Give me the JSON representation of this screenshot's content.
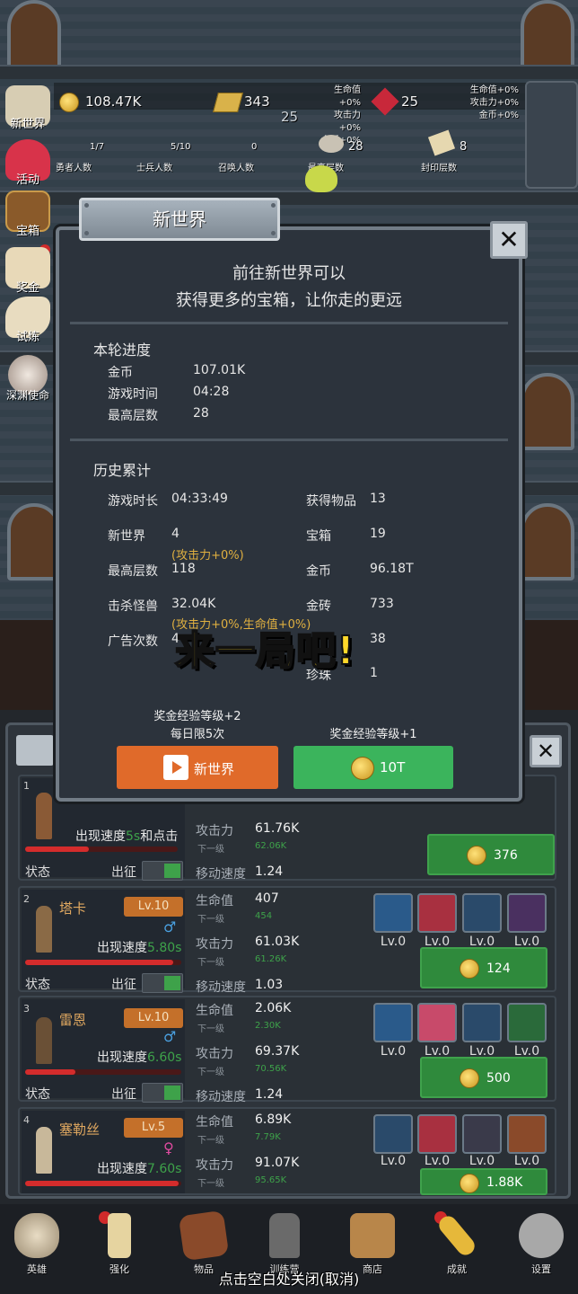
{
  "top": {
    "gold": "108.47K",
    "bricks": "343",
    "gem": "25",
    "stat_left": [
      "生命值+0%",
      "攻击力+0%",
      "金币+0%"
    ],
    "stat_right": [
      "生命值+0%",
      "攻击力+0%",
      "金币+0%"
    ],
    "floor_num": "25",
    "hero_count": "1/7",
    "hero_count_label": "勇者人数",
    "soldier_count": "5/10",
    "soldier_count_label": "士兵人数",
    "summon_count": "0",
    "summon_count_label": "召唤人数",
    "max_floor": "28",
    "max_floor_label": "最高层数",
    "seal_floor": "8",
    "seal_floor_label": "封印层数"
  },
  "side": [
    "新世界",
    "活动",
    "宝箱",
    "奖金",
    "试炼",
    "深渊使命"
  ],
  "dialog": {
    "title": "新世界",
    "close": "✕",
    "intro_line1": "前往新世界可以",
    "intro_line2": "获得更多的宝箱，让你走的更远",
    "round_title": "本轮进度",
    "round": [
      {
        "label": "金币",
        "value": "107.01K"
      },
      {
        "label": "游戏时间",
        "value": "04:28"
      },
      {
        "label": "最高层数",
        "value": "28"
      }
    ],
    "history_title": "历史累计",
    "history_left": [
      {
        "label": "游戏时长",
        "value": "04:33:49",
        "note": ""
      },
      {
        "label": "新世界",
        "value": "4",
        "note": "(攻击力+0%)"
      },
      {
        "label": "最高层数",
        "value": "118",
        "note": ""
      },
      {
        "label": "击杀怪兽",
        "value": "32.04K",
        "note": "(攻击力+0%,生命值+0%)"
      },
      {
        "label": "广告次数",
        "value": "4",
        "note": ""
      }
    ],
    "history_right": [
      {
        "label": "获得物品",
        "value": "13"
      },
      {
        "label": "宝箱",
        "value": "19"
      },
      {
        "label": "金币",
        "value": "96.18T"
      },
      {
        "label": "金砖",
        "value": "733"
      },
      {
        "label": "",
        "value": "38"
      },
      {
        "label": "珍珠",
        "value": "1"
      }
    ],
    "banner": "来一局吧!",
    "ad_note1": "奖金经验等级+2",
    "ad_note2": "每日限5次",
    "coin_note": "奖金经验等级+1",
    "ad_button": "新世界",
    "coin_button": "10T"
  },
  "heroes": [
    {
      "index": "1",
      "name": "",
      "level": "",
      "speed_prefix": "出现速度",
      "speed": "5s",
      "speed_suffix": "和点击",
      "status": "状态",
      "dispatch": "出征",
      "hp_label": "",
      "hp": "",
      "hp_next": "",
      "atk_label": "攻击力",
      "atk": "61.76K",
      "atk_next_label": "下一级",
      "atk_next": "62.06K",
      "move_label": "移动速度",
      "move": "1.24",
      "price": "376",
      "hp_fill": 0.42
    },
    {
      "index": "2",
      "name": "塔卡",
      "level": "Lv.10",
      "speed_prefix": "出现速度",
      "speed": "5.80s",
      "speed_suffix": "",
      "status": "状态",
      "dispatch": "出征",
      "hp_label": "生命值",
      "hp": "407",
      "hp_next_label": "下一级",
      "hp_next": "454",
      "atk_label": "攻击力",
      "atk": "61.03K",
      "atk_next_label": "下一级",
      "atk_next": "61.26K",
      "move_label": "移动速度",
      "move": "1.03",
      "skills": [
        "Lv.0",
        "Lv.0",
        "Lv.0",
        "Lv.0"
      ],
      "price": "124",
      "hp_fill": 0.95
    },
    {
      "index": "3",
      "name": "雷恩",
      "level": "Lv.10",
      "speed_prefix": "出现速度",
      "speed": "6.60s",
      "speed_suffix": "",
      "status": "状态",
      "dispatch": "出征",
      "hp_label": "生命值",
      "hp": "2.06K",
      "hp_next_label": "下一级",
      "hp_next": "2.30K",
      "atk_label": "攻击力",
      "atk": "69.37K",
      "atk_next_label": "下一级",
      "atk_next": "70.56K",
      "move_label": "移动速度",
      "move": "1.24",
      "skills": [
        "Lv.0",
        "Lv.0",
        "Lv.0",
        "Lv.0"
      ],
      "price": "500",
      "hp_fill": 0.32
    },
    {
      "index": "4",
      "name": "塞勒丝",
      "level": "Lv.5",
      "speed_prefix": "出现速度",
      "speed": "7.60s",
      "speed_suffix": "",
      "hp_label": "生命值",
      "hp": "6.89K",
      "hp_next_label": "下一级",
      "hp_next": "7.79K",
      "atk_label": "攻击力",
      "atk": "91.07K",
      "atk_next_label": "下一级",
      "atk_next": "95.65K",
      "skills": [
        "Lv.0",
        "Lv.0",
        "Lv.0",
        "Lv.0"
      ],
      "price": "1.88K",
      "hp_fill": 0.98
    }
  ],
  "nav": [
    "英雄",
    "强化",
    "物品",
    "训练营",
    "商店",
    "成就",
    "设置"
  ],
  "hint": "点击空白处关闭(取消)",
  "colors": {
    "accent_orange": "#e06a2a",
    "accent_green": "#3bb45c",
    "speed_green": "#3ea24a",
    "level_orange": "#c4702a"
  }
}
